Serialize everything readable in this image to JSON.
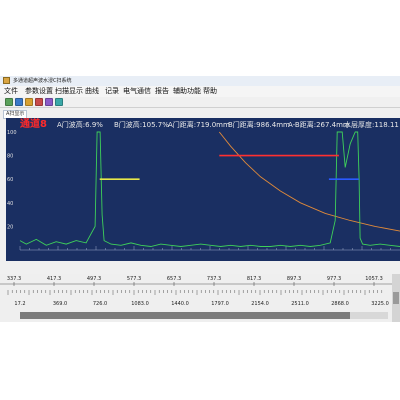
{
  "window": {
    "title": "多通道超声波水浸C扫系统"
  },
  "menu": {
    "items": [
      "文件",
      "参数设置",
      "扫描显示",
      "曲线",
      "记录",
      "电气通信",
      "报告",
      "辅助功能",
      "帮助"
    ]
  },
  "toolbar": {
    "button_colors": [
      "#5aa05a",
      "#3a78c8",
      "#d8a030",
      "#c84a4a",
      "#8a5ac8",
      "#3aa8a8"
    ]
  },
  "tab": {
    "label": "A扫显示"
  },
  "scope": {
    "channel_label": "通道8",
    "measurements": {
      "a_amp": "A门波高:6.9%",
      "b_amp": "B门波高:105.7%",
      "a_dist": "A门距离:719.0mm",
      "b_dist": "B门距离:986.4mm",
      "ab_dist": "A-B距离:267.4mm",
      "water": "水层厚度:118.11"
    },
    "gate_a_color": "#e8e84a",
    "gate_b_color": "#ff3030",
    "gate_c_color": "#2a5aff",
    "waveform_color": "#3ed05a",
    "dac_color": "#e08a3a"
  },
  "chart_data": {
    "type": "line",
    "ylim": [
      0,
      100
    ],
    "xlim": [
      337.3,
      1100
    ],
    "y_ticks": [
      100,
      80,
      60,
      40,
      20
    ],
    "x_ticks": [
      "337.3",
      "417.3",
      "497.3",
      "577.3",
      "657.3",
      "737.3",
      "817.3",
      "897.3",
      "977.3",
      "1057.3"
    ],
    "bottom_ticks": [
      "17.2",
      "369.0",
      "726.0",
      "1083.0",
      "1440.0",
      "1797.0",
      "2154.0",
      "2511.0",
      "2868.0",
      "3225.0"
    ],
    "series": [
      {
        "x": [
          337.3,
          350,
          370,
          390,
          410,
          430,
          450,
          470,
          488,
          492,
          495,
          498,
          502,
          506,
          520,
          540,
          560,
          580,
          600,
          620,
          640,
          660,
          680,
          700,
          720,
          740,
          760,
          780,
          800,
          820,
          840,
          860,
          880,
          900,
          920,
          940,
          960,
          970,
          974,
          976,
          978,
          980,
          984,
          990,
          1000,
          1010,
          1015,
          1018,
          1020,
          1025,
          1040,
          1060,
          1080,
          1100
        ],
        "y": [
          8,
          5,
          9,
          4,
          7,
          5,
          8,
          6,
          20,
          100,
          100,
          100,
          30,
          8,
          5,
          4,
          6,
          4,
          3,
          5,
          4,
          3,
          4,
          5,
          4,
          3,
          4,
          3,
          4,
          3,
          3,
          4,
          3,
          4,
          3,
          4,
          6,
          25,
          100,
          100,
          100,
          100,
          100,
          70,
          90,
          100,
          100,
          60,
          10,
          5,
          4,
          5,
          4,
          3
        ]
      }
    ],
    "dac_curve": {
      "x": [
        737.3,
        760,
        790,
        820,
        860,
        900,
        950,
        1000,
        1050,
        1100
      ],
      "y": [
        100,
        88,
        74,
        62,
        50,
        40,
        31,
        25,
        20,
        16
      ]
    },
    "gates": [
      {
        "name": "A",
        "x_start": 497.3,
        "x_end": 577.3,
        "y": 60
      },
      {
        "name": "B",
        "x_start": 737.3,
        "x_end": 977.3,
        "y": 80
      },
      {
        "name": "C",
        "x_start": 957.3,
        "x_end": 1017.3,
        "y": 60
      }
    ],
    "grid": false
  }
}
